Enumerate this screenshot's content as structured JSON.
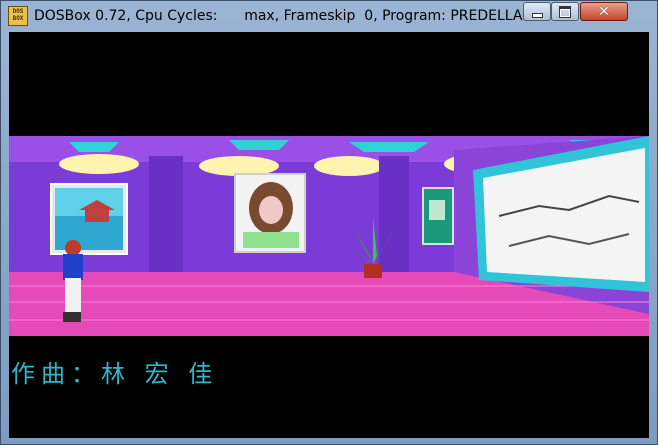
{
  "window": {
    "title": "DOSBox 0.72, Cpu Cycles:      max, Frameskip  0, Program: PREDELLA",
    "icon_text": "DOS BOX",
    "minimize_icon": "minimize-icon",
    "maximize_icon": "maximize-icon",
    "close_icon": "close-icon"
  },
  "game": {
    "subtitle": "作曲：林 宏 佳"
  },
  "colors": {
    "floor": "#e64ab8",
    "wall": "#7a3bd6",
    "ceiling": "#9a4fe6",
    "subtitle": "#2fb7c8"
  }
}
